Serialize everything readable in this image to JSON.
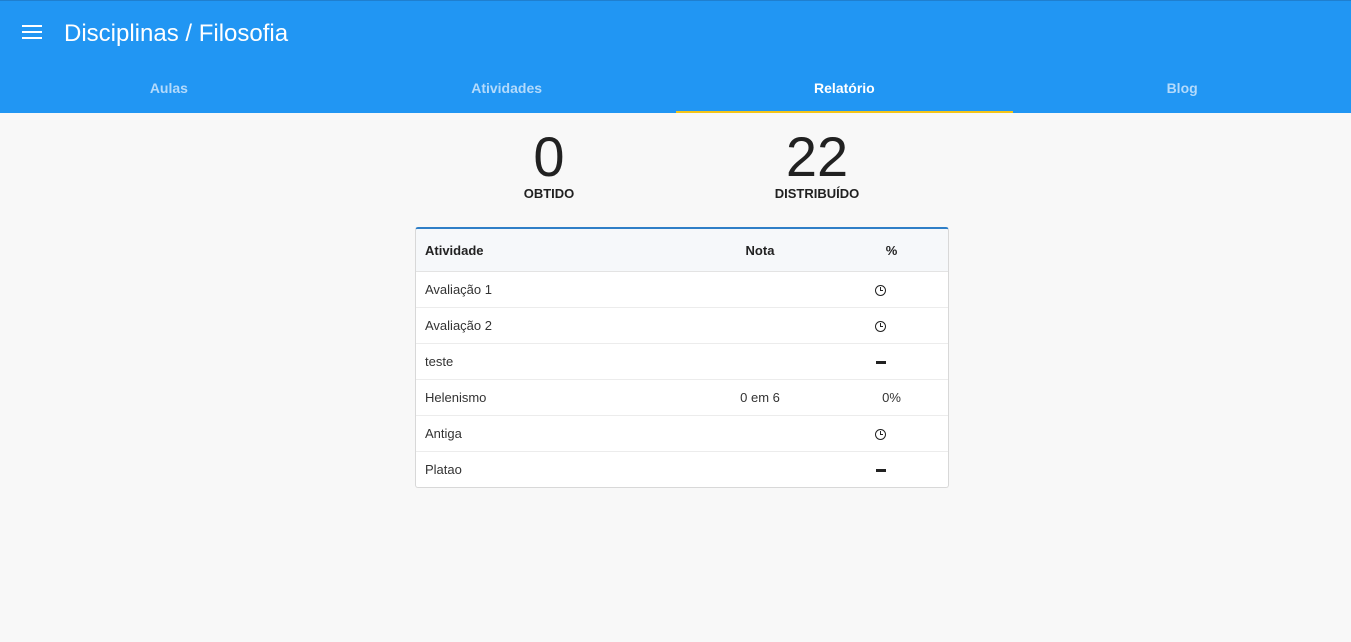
{
  "header": {
    "title": "Disciplinas / Filosofia",
    "menu_icon": "hamburger-menu-icon",
    "background_color": "#2196f3"
  },
  "tabs": [
    {
      "label": "Aulas",
      "active": false
    },
    {
      "label": "Atividades",
      "active": false
    },
    {
      "label": "Relatório",
      "active": true
    },
    {
      "label": "Blog",
      "active": false
    }
  ],
  "active_tab_indicator_color": "#f5c518",
  "stats": {
    "obtido": {
      "value": "0",
      "label": "OBTIDO"
    },
    "distribuido": {
      "value": "22",
      "label": "DISTRIBUÍDO"
    }
  },
  "table": {
    "headers": {
      "atividade": "Atividade",
      "nota": "Nota",
      "percent": "%"
    },
    "rows": [
      {
        "atividade": "Avaliação 1",
        "status_icon": "clock-icon",
        "nota": "",
        "percent": ""
      },
      {
        "atividade": "Avaliação 2",
        "status_icon": "clock-icon",
        "nota": "",
        "percent": ""
      },
      {
        "atividade": "teste",
        "status_icon": "dash-icon",
        "nota": "",
        "percent": ""
      },
      {
        "atividade": "Helenismo",
        "status_icon": "",
        "nota": "0 em 6",
        "percent": "0%"
      },
      {
        "atividade": "Antiga",
        "status_icon": "clock-icon",
        "nota": "",
        "percent": ""
      },
      {
        "atividade": "Platao",
        "status_icon": "dash-icon",
        "nota": "",
        "percent": ""
      }
    ]
  }
}
